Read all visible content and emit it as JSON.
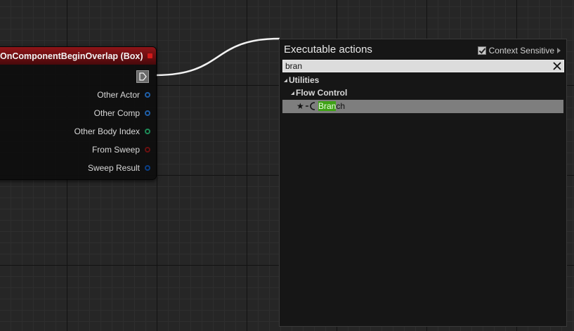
{
  "node": {
    "title": "OnComponentBeginOverlap (Box)",
    "header_color": "#8f1518",
    "pins": [
      {
        "label": "Other Actor",
        "color": "#1f5fa8"
      },
      {
        "label": "Other Comp",
        "color": "#1f5fa8"
      },
      {
        "label": "Other Body Index",
        "color": "#1e8a57"
      },
      {
        "label": "From Sweep",
        "color": "#6a1010"
      },
      {
        "label": "Sweep Result",
        "color": "#0a3f86"
      }
    ]
  },
  "menu": {
    "title": "Executable actions",
    "context_sensitive_label": "Context Sensitive",
    "context_sensitive_checked": true,
    "search_value": "bran",
    "categories": [
      {
        "label": "Utilities"
      },
      {
        "label": "Flow Control"
      }
    ],
    "result": {
      "match": "Bran",
      "rest": "ch",
      "highlight_color": "#3fa116",
      "selected_bg": "#7e7e7e"
    }
  }
}
